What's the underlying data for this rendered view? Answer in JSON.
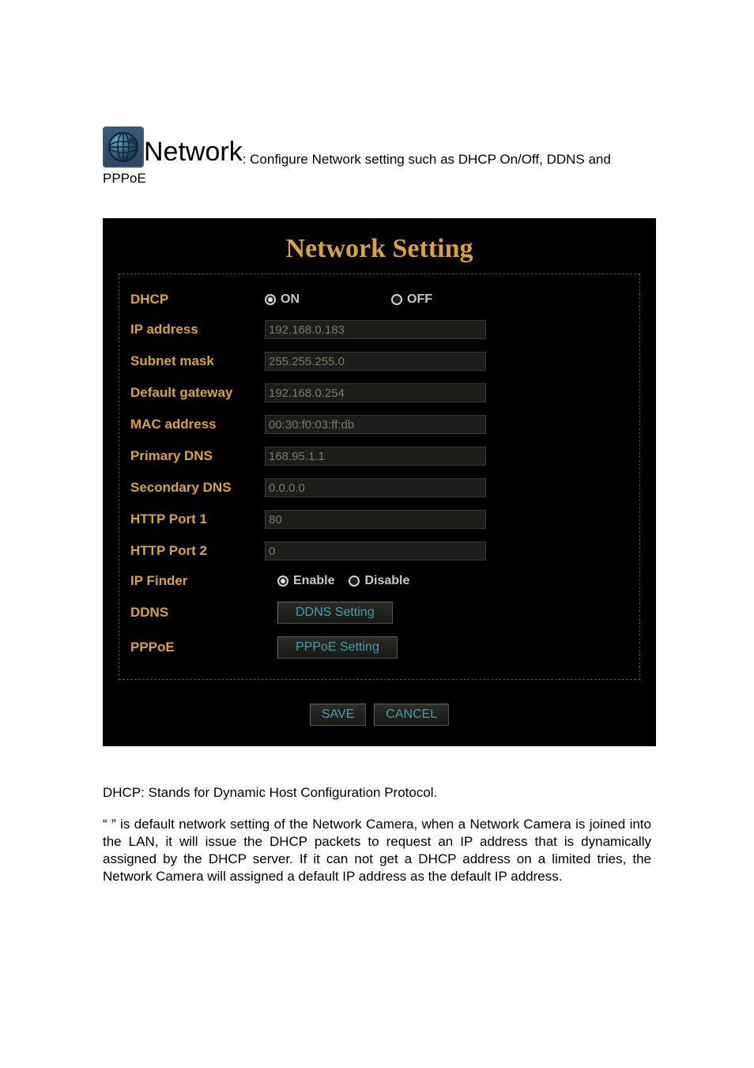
{
  "intro": {
    "title": "Network",
    "desc": ": Configure Network setting such as DHCP On/Off, DDNS and",
    "desc2": "PPPoE"
  },
  "panel": {
    "title": "Network Setting",
    "labels": {
      "dhcp": "DHCP",
      "ip": "IP address",
      "subnet": "Subnet mask",
      "gateway": "Default gateway",
      "mac": "MAC address",
      "dns1": "Primary DNS",
      "dns2": "Secondary DNS",
      "http1": "HTTP Port 1",
      "http2": "HTTP Port 2",
      "ipfinder": "IP Finder",
      "ddns": "DDNS",
      "pppoe": "PPPoE"
    },
    "dhcp": {
      "on_label": "ON",
      "off_label": "OFF",
      "selected": "on"
    },
    "fields": {
      "ip": "192.168.0.183",
      "subnet": "255.255.255.0",
      "gateway": "192.168.0.254",
      "mac": "00:30:f0:03:ff:db",
      "dns1": "168.95.1.1",
      "dns2": "0.0.0.0",
      "http1": "80",
      "http2": "0"
    },
    "ipfinder": {
      "enable_label": "Enable",
      "disable_label": "Disable",
      "selected": "enable"
    },
    "buttons": {
      "ddns": "DDNS Setting",
      "pppoe": "PPPoE Setting",
      "save": "SAVE",
      "cancel": "CANCEL"
    }
  },
  "description": {
    "p1": "DHCP: Stands for Dynamic Host Configuration Protocol.",
    "p2": "“                  ” is default network setting of the Network Camera, when a Network Camera is joined into the LAN, it will issue the DHCP packets to request an IP address that is dynamically assigned by the DHCP server. If it can not get a DHCP address on a limited tries, the Network Camera will assigned a default IP address as the default IP address."
  }
}
